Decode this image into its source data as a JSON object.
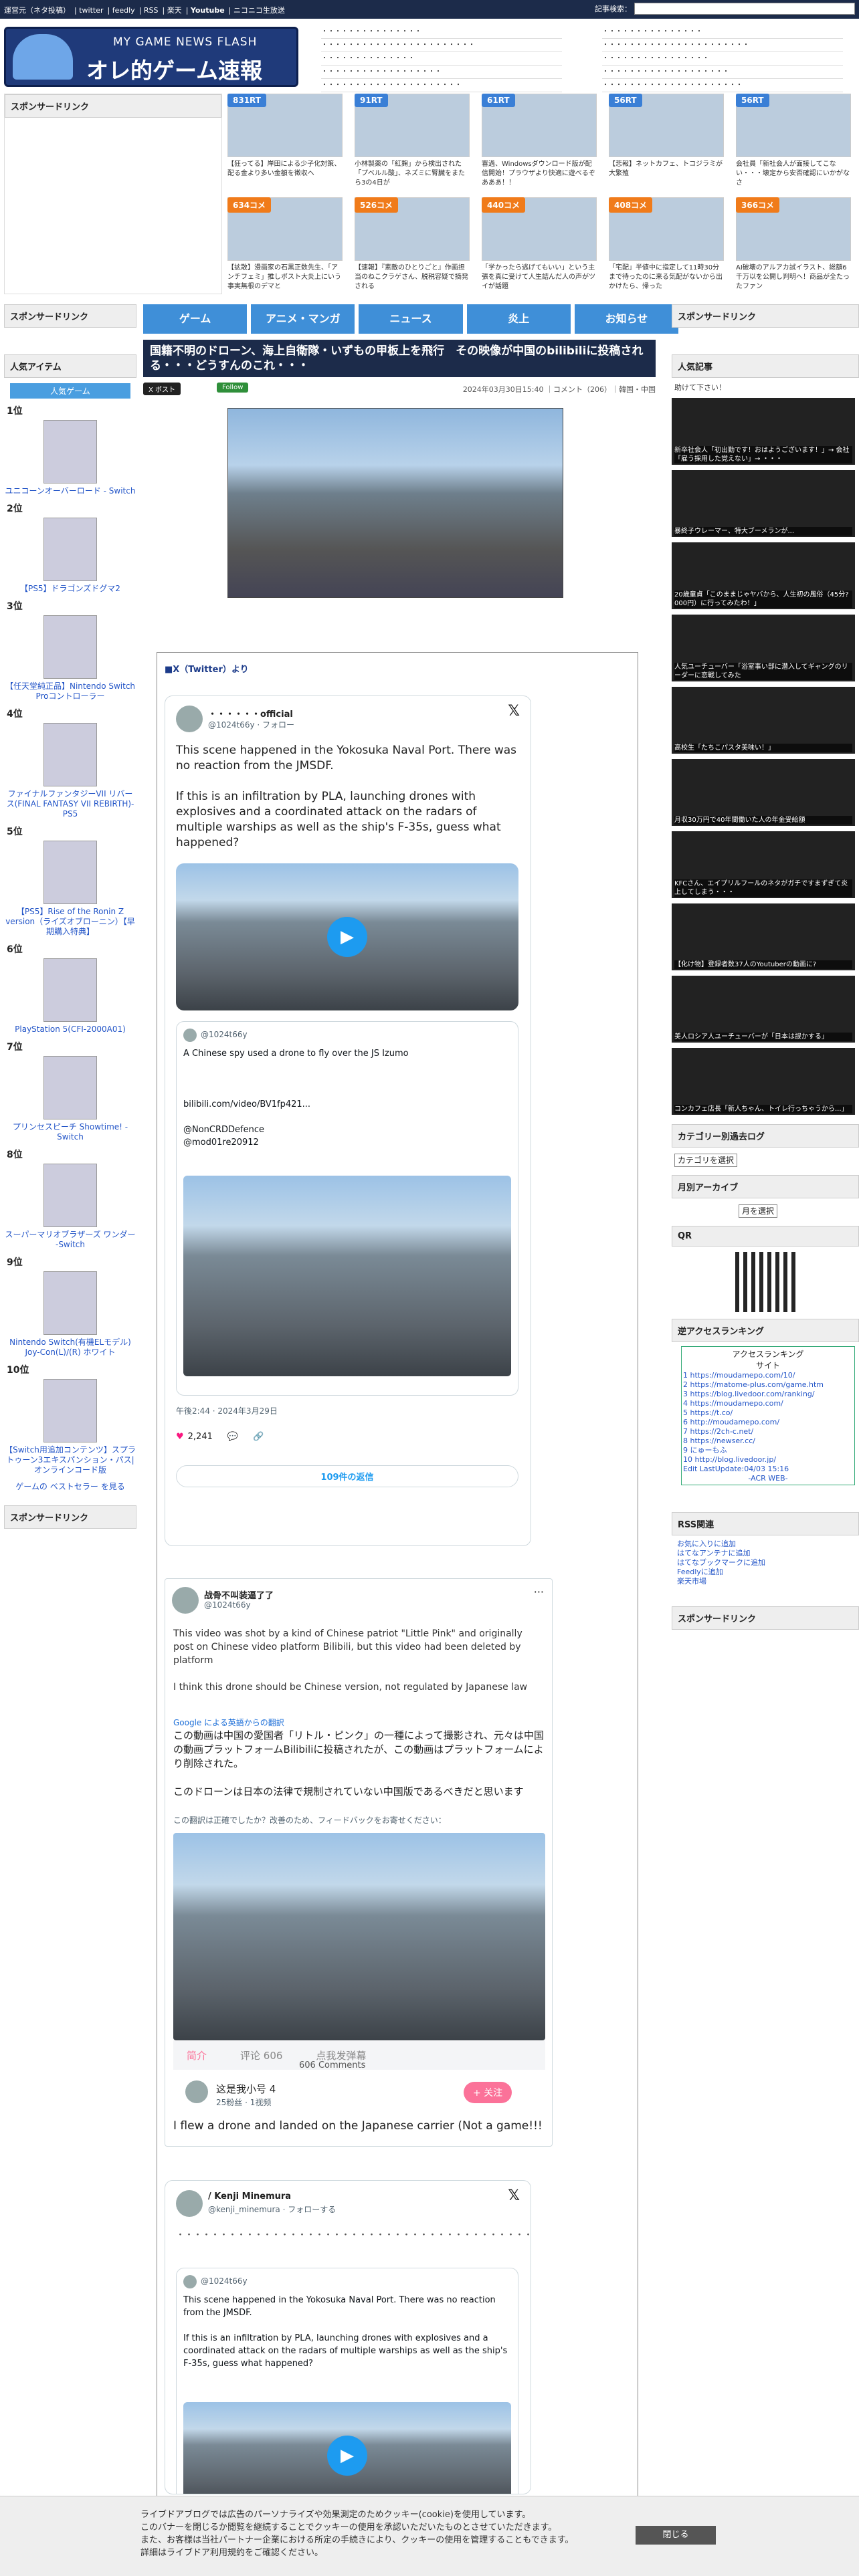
{
  "topbar": {
    "links": [
      "運営元（ネタ投稿）",
      "twitter",
      "feedly",
      "RSS",
      "楽天",
      "Youtube",
      "ニコニコ生放送"
    ],
    "search_label": "記事検索：",
    "search_value": ""
  },
  "header": {
    "logo_sub": "MY GAME NEWS FLASH",
    "logo_main": "オレ的ゲーム速報@JIN",
    "headlines_a": [
      "",
      "",
      "",
      "",
      ""
    ],
    "headlines_b": [
      "",
      "",
      "",
      "",
      ""
    ]
  },
  "sponsor_label": "スポンサードリンク",
  "rt_items": [
    {
      "badge": "831RT",
      "caption": "【狂ってる】岸田による少子化対策、配る金より多い金額を徴収へ",
      "type": "rt"
    },
    {
      "badge": "91RT",
      "caption": "小林製薬の「紅麹」から検出された「プベルル酸」、ネズミに腎臓をまたら3の4日が",
      "type": "rt"
    },
    {
      "badge": "61RT",
      "caption": "審過、Windowsダウンロード版が配信開始！プラウザより快適に遊べるぞあああ！！",
      "type": "rt"
    },
    {
      "badge": "56RT",
      "caption": "【悲報】ネットカフェ、トコジラミが大繁殖",
      "type": "rt"
    },
    {
      "badge": "56RT",
      "caption": "会社員「新社会人が面接してこない・・・壊定から安否確認にいかがなさ",
      "type": "rt"
    },
    {
      "badge": "634コメ",
      "caption": "【拡散】漫画家の石黒正数先生、「アンチフェミ」推しポスト大炎上にいう事実無根のデマと",
      "type": "co"
    },
    {
      "badge": "526コメ",
      "caption": "【速報】『素敵のひとりごと』作画担当のねこクラゲさん、脱税容疑で摘発される",
      "type": "co"
    },
    {
      "badge": "440コメ",
      "caption": "「学かったら逃げてもいい」という主張を真に受けて人生詰んだ人の声がツイが話題",
      "type": "co"
    },
    {
      "badge": "408コメ",
      "caption": "「宅配」半値中に指定して11時30分まで待ったのに来る気配がないから出かけたら、帰った",
      "type": "co"
    },
    {
      "badge": "366コメ",
      "caption": "AI破壊のアルアカ試イラスト、総額6千万以を公開し判明へ！商品が全たったファン",
      "type": "co"
    }
  ],
  "nav": [
    "ゲーム",
    "アニメ・マンガ",
    "ニュース",
    "炎上",
    "お知らせ"
  ],
  "left": {
    "sponsor": "スポンサードリンク",
    "popular": "人気アイテム",
    "tab": "人気ゲーム",
    "ranks": [
      {
        "rank": "1位",
        "name": "ユニコーンオーバーロード - Switch"
      },
      {
        "rank": "2位",
        "name": "【PS5】ドラゴンズドグマ2"
      },
      {
        "rank": "3位",
        "name": "【任天堂純正品】Nintendo Switch Proコントローラー"
      },
      {
        "rank": "4位",
        "name": "ファイナルファンタジーVII リバース(FINAL FANTASY VII REBIRTH)-PS5"
      },
      {
        "rank": "5位",
        "name": "【PS5】Rise of the Ronin Z version（ライズオブローニン）【早期購入特典】"
      },
      {
        "rank": "6位",
        "name": "PlayStation 5(CFI-2000A01)"
      },
      {
        "rank": "7位",
        "name": "プリンセスピーチ Showtime! -Switch"
      },
      {
        "rank": "8位",
        "name": "スーパーマリオブラザーズ ワンダー -Switch"
      },
      {
        "rank": "9位",
        "name": "Nintendo Switch(有機ELモデル) Joy-Con(L)/(R) ホワイト"
      },
      {
        "rank": "10位",
        "name": "【Switch用追加コンテンツ】スプラトゥーン3エキスパンション・パス|オンラインコード版"
      }
    ],
    "more": "ゲームの ベストセラー を見る",
    "sponsor2": "スポンサードリンク"
  },
  "article": {
    "title": "国籍不明のドローン、海上自衛隊・いずもの甲板上を飛行　その映像が中国のbilibiliに投稿される・・・どうすんのこれ・・・",
    "x_btn": "X ポスト",
    "follow_btn": "Follow",
    "meta": "2024年03月30日15:40 ｜コメント（206）｜韓国・中国",
    "x_header": "■X（Twitter）より"
  },
  "tweet1": {
    "name": "",
    "handle": "@1024t66y · フォロー",
    "text": "This scene happened in the Yokosuka Naval Port. There was no reaction from the JMSDF.\n\nIf this is an infiltration by PLA, launching drones with explosives and a coordinated attack on the radars of multiple warships as well as the ship's F-35s, guess what happened?",
    "quote_name": "@1024t66y",
    "quote_text": "A Chinese spy used a drone to fly over the JS Izumo\n\n\n\nbilibili.com/video/BV1fp421...\n\n@NonCRDDefence\n@mod01re20912",
    "time": "午後2:44 · 2024年3月29日",
    "likes": "2,241",
    "reply_btn": "109件の返信"
  },
  "tweet2": {
    "name": "战骨不叫装逼了了",
    "handle": "@1024t66y",
    "text": "This video was shot by a kind of Chinese patriot \"Little Pink\" and originally post on Chinese video platform Bilibili, but this video had been deleted by platform\n\nI think this drone should be Chinese version, not regulated by Japanese law",
    "translate": "Google による英語からの翻訳",
    "ja_text": "この動画は中国の愛国者「リトル・ピンク」の一種によって撮影され、元々は中国の動画プラットフォームBilibiliに投稿されたが、この動画はプラットフォームにより削除された。\n\nこのドローンは日本の法律で規制されていない中国版であるべきだと思います",
    "feedback": "この翻訳は正確でしたか？改善のため、フィードバックをお寄せください：",
    "tabs": [
      "简介",
      "评论 606",
      "点我发弹幕"
    ],
    "comments": "606 Comments",
    "user": "这是我小号 4",
    "user_sub": "25粉丝 · 1视频",
    "follow": "+ 关注",
    "caption": "I flew a drone and landed on the Japanese carrier (Not a game!!!"
  },
  "tweet3": {
    "name": "/ Kenji Minemura",
    "handle": "@kenji_minemura · フォローする",
    "quote_name": "@1024t66y",
    "quote_text": "This scene happened in the Yokosuka Naval Port. There was no reaction from the JMSDF.\n\nIf this is an infiltration by PLA, launching drones with explosives and a coordinated attack on the radars of multiple warships as well as the ship's F-35s, guess what happened?"
  },
  "right": {
    "sponsor": "スポンサードリンク",
    "popular": "人気記事",
    "intro": "助けて下さい！",
    "items": [
      "新卒社会人「初出勤です！おはようございます！」→ 会社「雇う採用した覚えない」→ ・・・",
      "暴終子ウレーマー、特大ブーメランが...",
      "20歳童貞「このままじゃヤバから、人生初の風俗（45分?000円）に行ってみたわ！」",
      "人気ユーチューバー「浴室事い部に潜入してギャングのリーダーに恋戦してみた",
      "高校生「たちこパスタ美味い！」",
      "月収30万円で40年間働いた人の年金受給額",
      "KFCさん、エイプリルフールのネタがガチですまずぎて炎上してしまう・・・",
      "【化け物】登録者数37人のYoutuberの動画に?",
      "美人ロシア人ユーチューバーが「日本は誤かする」",
      "コンカフェ店長「新人ちゃん、トイレ行っちゃうから...」"
    ],
    "cat_title": "カテゴリー別過去ログ",
    "cat_select": "カテゴリを選択",
    "arc_title": "月別アーカイブ",
    "arc_select": "月を選択",
    "qr_title": "QR",
    "access_title": "逆アクセスランキング",
    "access_head": "アクセスランキング",
    "access_sub": "サイト",
    "access_rows": [
      "https://moudamepo.com/10/",
      "https://matome-plus.com/game.htm",
      "https://blog.livedoor.com/ranking/",
      "https://moudamepo.com/",
      "https://t.co/",
      "http://moudamepo.com/",
      "https://2ch-c.net/",
      "https://newser.cc/",
      "にゅーもふ",
      "http://blog.livedoor.jp/"
    ],
    "access_footer": "Edit LastUpdate:04/03 15:16",
    "access_web": "-ACR WEB-",
    "rss_title": "RSS関連",
    "rss_links": [
      "お気に入りに追加",
      "はてなアンテナに追加",
      "はてなブックマークに追加",
      "Feedlyに追加",
      "楽天市場"
    ],
    "sponsor2": "スポンサードリンク"
  },
  "cookie": {
    "text": "ライブドアブログでは広告のパーソナライズや効果測定のためクッキー(cookie)を使用しています。\nこのバナーを閉じるか閲覧を継続することでクッキーの使用を承認いただいたものとさせていただきます。\nまた、お客様は当社パートナー企業における所定の手続きにより、クッキーの使用を管理することもできます。\n詳細はライブドア利用規約をご確認ください。",
    "button": "閉じる"
  }
}
